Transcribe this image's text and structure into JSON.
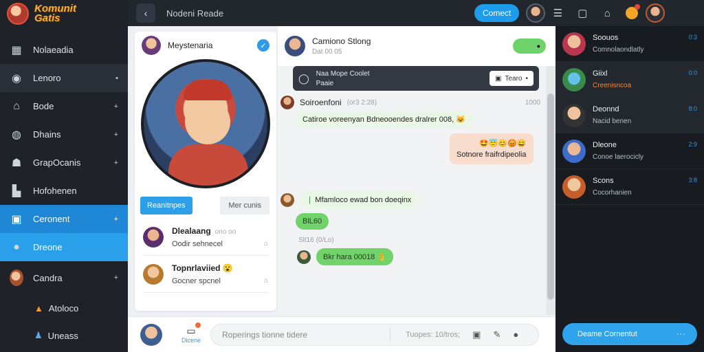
{
  "logo": {
    "text_line1": "Komunit",
    "text_line2": "Gatis"
  },
  "sidebar": {
    "items": [
      {
        "label": "Nolaeadia",
        "icon": "grid-icon",
        "chevron": ""
      },
      {
        "label": "Lenoro",
        "icon": "globe-icon",
        "chevron": "•"
      },
      {
        "label": "Bode",
        "icon": "home-icon",
        "chevron": "+"
      },
      {
        "label": "Dhains",
        "icon": "world-icon",
        "chevron": "+"
      },
      {
        "label": "GrapOcanis",
        "icon": "group-icon",
        "chevron": "+"
      },
      {
        "label": "Hofohenen",
        "icon": "building-icon",
        "chevron": ""
      },
      {
        "label": "Ceronent",
        "icon": "monitor-icon",
        "chevron": "+"
      },
      {
        "label": "Dreone",
        "icon": "chat-bubble-icon",
        "chevron": ""
      },
      {
        "label": "Candra",
        "icon": "avatar",
        "chevron": "+"
      }
    ],
    "sub_items": [
      {
        "label": "Atoloco",
        "icon": "flame-icon"
      },
      {
        "label": "Uneass",
        "icon": "users-icon"
      }
    ]
  },
  "topbar": {
    "back": "‹",
    "title": "Nodeni Reade",
    "action_label": "Comect"
  },
  "profile": {
    "name": "Meystenaria",
    "verified": "✓",
    "primary_btn": "Reanitnpes",
    "secondary_btn": "Mer cunis",
    "contacts": [
      {
        "name": "Dlealaang",
        "time": "ono oo",
        "sub": "Oodir sehnecel",
        "icon": "⌂"
      },
      {
        "name": "Topnrlaviied",
        "time": "",
        "emoji": "😮",
        "sub": "Gocner spcnel",
        "icon": "⌂"
      }
    ]
  },
  "chat": {
    "name": "Camiono Stlong",
    "status": "Dat 00 05",
    "pinned_text_1": "Naa Mope Coolet",
    "pinned_text_2": "Paaie",
    "pinned_btn": "Tearo",
    "messages": [
      {
        "author": "Soiroenfoni",
        "meta": "(or3 2:28)",
        "time": "1000",
        "text": "Catiroe voreenyan Bdneooendes dralrer 008,",
        "emoji": "😺"
      },
      {
        "emojis": "🤩😇😊😡😄",
        "text": "Sotnore fraifrdipeolia"
      },
      {
        "text": "Mfamloco ewad bon doeqinx"
      },
      {
        "text": "BlL60"
      },
      {
        "time": "Slt16 (0/Lo)"
      },
      {
        "text": "Bkr hara 00018",
        "emoji": "👌"
      }
    ]
  },
  "composer": {
    "tool_label": "Dicene",
    "placeholder": "Roperings tionne tidere",
    "meta": "Tuopes: 10/tros;"
  },
  "right_panel": {
    "conversations": [
      {
        "name": "Soouos",
        "time": "0:3",
        "sub": "Comnolaondlatly",
        "sub_color": "default"
      },
      {
        "name": "Giixl",
        "time": "0:0",
        "sub": "Creenisncoa",
        "sub_color": "orange"
      },
      {
        "name": "Deonnd",
        "time": "8:0",
        "sub": "Nacid benen",
        "sub_color": "default"
      },
      {
        "name": "Dleone",
        "time": "2:9",
        "sub": "Conoe laerocicly",
        "sub_color": "default"
      },
      {
        "name": "Scons",
        "time": "3:8",
        "sub": "Cocorhanien",
        "sub_color": "default"
      }
    ],
    "cta_label": "Deame Cornentut",
    "cta_more": "···"
  }
}
